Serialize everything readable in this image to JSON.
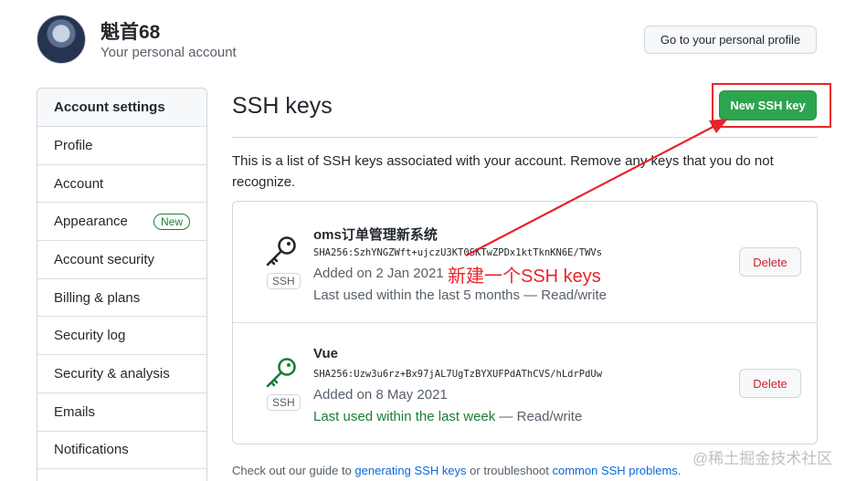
{
  "user": {
    "name": "魁首68",
    "subtitle": "Your personal account",
    "profile_button": "Go to your personal profile"
  },
  "sidebar": {
    "heading": "Account settings",
    "items": [
      {
        "label": "Profile"
      },
      {
        "label": "Account"
      },
      {
        "label": "Appearance",
        "badge": "New"
      },
      {
        "label": "Account security"
      },
      {
        "label": "Billing & plans"
      },
      {
        "label": "Security log"
      },
      {
        "label": "Security & analysis"
      },
      {
        "label": "Emails"
      },
      {
        "label": "Notifications"
      }
    ]
  },
  "main": {
    "title": "SSH keys",
    "new_key_button": "New SSH key",
    "description": "This is a list of SSH keys associated with your account. Remove any keys that you do not recognize.",
    "keys": [
      {
        "title": "oms订单管理新系统",
        "sha": "SHA256:SzhYNGZWft+ujczU3KT0SKTwZPDx1ktTknKN6E/TWVs",
        "added": "Added on 2 Jan 2021",
        "used_recent": "",
        "used_rest": "Last used within the last 5 months — Read/write",
        "type_label": "SSH",
        "delete_label": "Delete",
        "icon_color": "#24292f"
      },
      {
        "title": "Vue",
        "sha": "SHA256:Uzw3u6rz+Bx97jAL7UgTzBYXUFPdAThCVS/hLdrPdUw",
        "added": "Added on 8 May 2021",
        "used_recent": "Last used within the last week",
        "used_rest": " — Read/write",
        "type_label": "SSH",
        "delete_label": "Delete",
        "icon_color": "#1a7f37"
      }
    ],
    "annotation": "新建一个SSH keys",
    "footer": {
      "prefix": "Check out our guide to ",
      "link1": "generating SSH keys",
      "middle": " or troubleshoot ",
      "link2": "common SSH problems",
      "suffix": "."
    }
  },
  "watermark": "@稀土掘金技术社区",
  "colors": {
    "primary_button": "#2da44e",
    "annotation_red": "#e8232b",
    "link": "#0969da",
    "danger": "#cf222e"
  }
}
